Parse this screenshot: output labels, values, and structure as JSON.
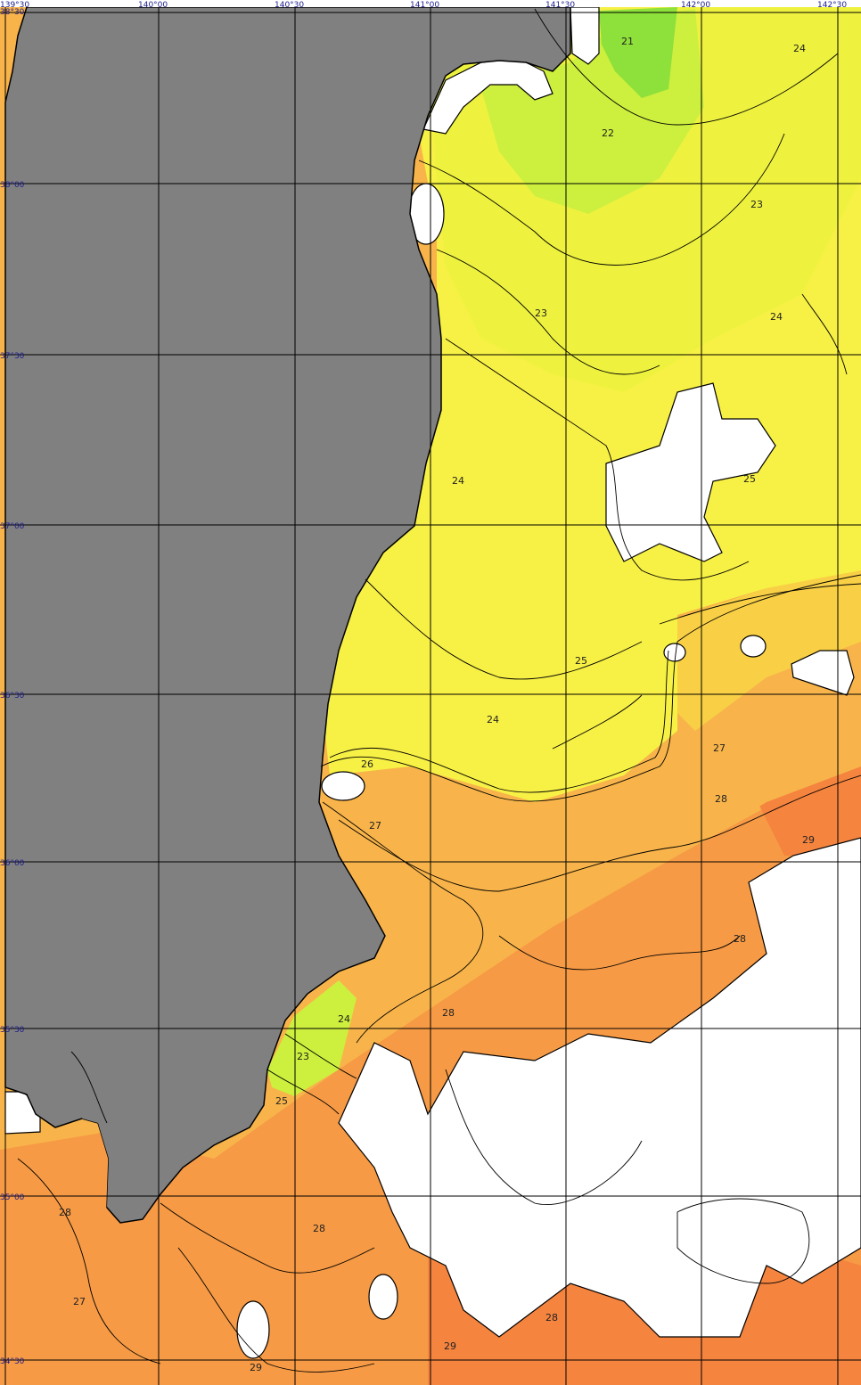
{
  "map": {
    "longitude_labels": [
      "139°30",
      "140°00",
      "140°30",
      "141°00",
      "141°30",
      "142°00",
      "142°30"
    ],
    "latitude_labels": [
      "38°30",
      "38°00",
      "37°30",
      "37°00",
      "36°30",
      "36°00",
      "35°30",
      "35°00",
      "34°30"
    ],
    "isotherm_labels": [
      "21",
      "22",
      "23",
      "23",
      "24",
      "24",
      "24",
      "25",
      "25",
      "24",
      "26",
      "27",
      "27",
      "28",
      "29",
      "28",
      "24",
      "28",
      "23",
      "25",
      "28",
      "28",
      "27",
      "29",
      "28",
      "29"
    ],
    "colors": {
      "land": "#808080",
      "no_data": "#ffffff",
      "temp_21": "#8ee03a",
      "temp_22": "#cdef3e",
      "temp_23": "#eef23e",
      "temp_24": "#f7f045",
      "temp_25": "#f6e240",
      "temp_26": "#f8cf45",
      "temp_27": "#f8b44a",
      "temp_28": "#f69a45",
      "temp_29": "#f5843f",
      "grid": "#000000",
      "coast": "#000000"
    }
  }
}
